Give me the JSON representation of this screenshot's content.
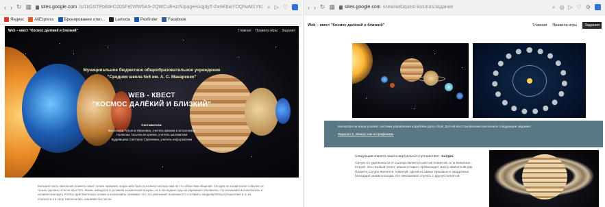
{
  "left_window": {
    "url_host": "sites.google.com",
    "url_path": "/s/1kGSTPb8deOJ0SFrEWW5AS-2QWCuEnzrN/page/skqjdyT-ZaSEbwYOQhwM1YK1fQK8f",
    "bookmarks": [
      {
        "label": "Яндекс",
        "color": "#e03a2f"
      },
      {
        "label": "AliExpress",
        "color": "#e85a1b"
      },
      {
        "label": "Бронирование отел...",
        "color": "#1f55b5"
      },
      {
        "label": "Lamoda",
        "color": "#222222"
      },
      {
        "label": "Pexfinder",
        "color": "#1f55b5"
      },
      {
        "label": "Facebook",
        "color": "#3b5998"
      }
    ],
    "hero": {
      "site_title": "Web – квест \"Космос далёкий и близкий\"",
      "nav": [
        "Главная",
        "Правила игры",
        "Задания"
      ],
      "org_line1": "Муниципальное бюджетное общеобразовательное учреждение",
      "org_line2": "\"Средняя школа №6 им. А. С. Макаренко\"",
      "title_line1": "WEB - КВЕСТ",
      "title_line2": "\"КОСМОС ДАЛЁКИЙ И БЛИЗКИЙ\"",
      "authors_header": "Составители:",
      "authors": [
        "Васильева Татьяна Ивановна, учитель физики и астрономии",
        "Полякова Татьяна Игоревна, учитель математики",
        "Кудрявцева Светлана Сергеевна, учитель информатики"
      ]
    },
    "body_text": "Большая часть населения планеты знает только названия, когда-либо было в космосе сколько нам лет-то областями общения. Сегодня не космическое событие не только сделано отчетов простого. Жизнь наводятся в условиях космической прорвы, но в последние годы на карнавале объявлено, что космонавтов полюбилось в космическом кругу. Космос действительно сложен и космонавты понимают это; это уменьшает возможность составить смоделировать путешествие в то из плоскости и в силу. Наполнились знаниями без числа."
  },
  "right_window": {
    "url_host": "sites.google.com",
    "url_path": "/view/webquest-kosmos/задание",
    "site_title": "Web – квест \"Космос далёкий и близкий\"",
    "nav": [
      "Главная",
      "Правила игры",
      "Задания"
    ],
    "active_nav": "Задания",
    "band_text": "Несмотря на ваши усилия, система управления кораблём дала сбой. Для её восстановления выполните следующее задание:",
    "band_link": "Задание 2. Знание как астрофизика.",
    "saturn_lead_prefix": "Следующая планета нашего виртуального путешествия - ",
    "saturn_lead_name": "Сатурн.",
    "saturn_body": "Сатурн по удалённости от Солнца является шестой планетой, а по величине - второй. Это газовый гигант, масса которого превосходит массу Земли в 95 раз. Планета Сатурн является, пожалуй, одной из самых красивых и загадочных благодаря своим кольцам, его невозможно спутать с другой планетой."
  },
  "colors": {
    "band_bg": "#5a7784",
    "org_text": "#f4e9b8",
    "active_nav_bg": "#2a2a2a"
  }
}
